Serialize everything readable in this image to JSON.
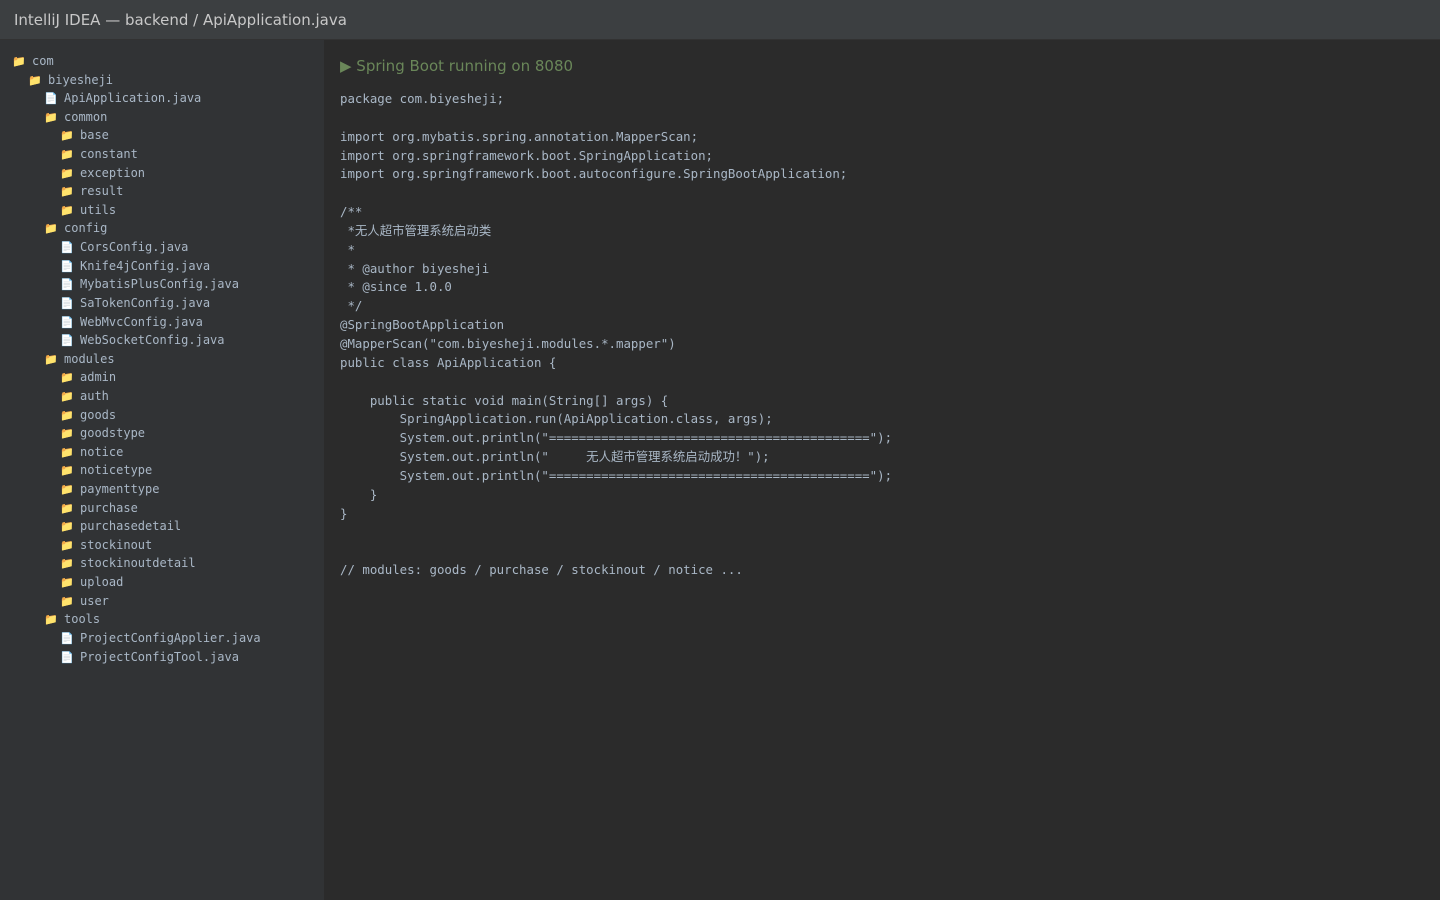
{
  "window": {
    "title": "IntelliJ IDEA — backend / ApiApplication.java"
  },
  "project_tree": [
    {
      "label": "com",
      "kind": "folder",
      "depth": 0
    },
    {
      "label": "biyesheji",
      "kind": "folder",
      "depth": 1
    },
    {
      "label": "ApiApplication.java",
      "kind": "file",
      "depth": 2
    },
    {
      "label": "common",
      "kind": "folder",
      "depth": 2
    },
    {
      "label": "base",
      "kind": "folder",
      "depth": 3
    },
    {
      "label": "constant",
      "kind": "folder",
      "depth": 3
    },
    {
      "label": "exception",
      "kind": "folder",
      "depth": 3
    },
    {
      "label": "result",
      "kind": "folder",
      "depth": 3
    },
    {
      "label": "utils",
      "kind": "folder",
      "depth": 3
    },
    {
      "label": "config",
      "kind": "folder",
      "depth": 2
    },
    {
      "label": "CorsConfig.java",
      "kind": "file",
      "depth": 3
    },
    {
      "label": "Knife4jConfig.java",
      "kind": "file",
      "depth": 3
    },
    {
      "label": "MybatisPlusConfig.java",
      "kind": "file",
      "depth": 3
    },
    {
      "label": "SaTokenConfig.java",
      "kind": "file",
      "depth": 3
    },
    {
      "label": "WebMvcConfig.java",
      "kind": "file",
      "depth": 3
    },
    {
      "label": "WebSocketConfig.java",
      "kind": "file",
      "depth": 3
    },
    {
      "label": "modules",
      "kind": "folder",
      "depth": 2
    },
    {
      "label": "admin",
      "kind": "folder",
      "depth": 3
    },
    {
      "label": "auth",
      "kind": "folder",
      "depth": 3
    },
    {
      "label": "goods",
      "kind": "folder",
      "depth": 3
    },
    {
      "label": "goodstype",
      "kind": "folder",
      "depth": 3
    },
    {
      "label": "notice",
      "kind": "folder",
      "depth": 3
    },
    {
      "label": "noticetype",
      "kind": "folder",
      "depth": 3
    },
    {
      "label": "paymenttype",
      "kind": "folder",
      "depth": 3
    },
    {
      "label": "purchase",
      "kind": "folder",
      "depth": 3
    },
    {
      "label": "purchasedetail",
      "kind": "folder",
      "depth": 3
    },
    {
      "label": "stockinout",
      "kind": "folder",
      "depth": 3
    },
    {
      "label": "stockinoutdetail",
      "kind": "folder",
      "depth": 3
    },
    {
      "label": "upload",
      "kind": "folder",
      "depth": 3
    },
    {
      "label": "user",
      "kind": "folder",
      "depth": 3
    },
    {
      "label": "tools",
      "kind": "folder",
      "depth": 2
    },
    {
      "label": "ProjectConfigApplier.java",
      "kind": "file",
      "depth": 3
    },
    {
      "label": "ProjectConfigTool.java",
      "kind": "file",
      "depth": 3
    }
  ],
  "icons": {
    "folder": "folder-icon",
    "file": "file-icon",
    "run": "run-icon"
  },
  "colors": {
    "folder": "#e4b84f",
    "file": "#d9dde2",
    "run_status": "#6a8759",
    "code_text": "#a9b7c6"
  },
  "editor": {
    "run_status": "▶ Spring Boot running on 8080",
    "code_lines": [
      "package com.biyesheji;",
      "",
      "import org.mybatis.spring.annotation.MapperScan;",
      "import org.springframework.boot.SpringApplication;",
      "import org.springframework.boot.autoconfigure.SpringBootApplication;",
      "",
      "/**",
      " *无人超市管理系统启动类",
      " *",
      " * @author biyesheji",
      " * @since 1.0.0",
      " */",
      "@SpringBootApplication",
      "@MapperScan(\"com.biyesheji.modules.*.mapper\")",
      "public class ApiApplication {",
      "",
      "    public static void main(String[] args) {",
      "        SpringApplication.run(ApiApplication.class, args);",
      "        System.out.println(\"===========================================\");",
      "        System.out.println(\"     无人超市管理系统启动成功！\");",
      "        System.out.println(\"===========================================\");",
      "    }",
      "}",
      "",
      "",
      "// modules: goods / purchase / stockinout / notice ..."
    ]
  }
}
